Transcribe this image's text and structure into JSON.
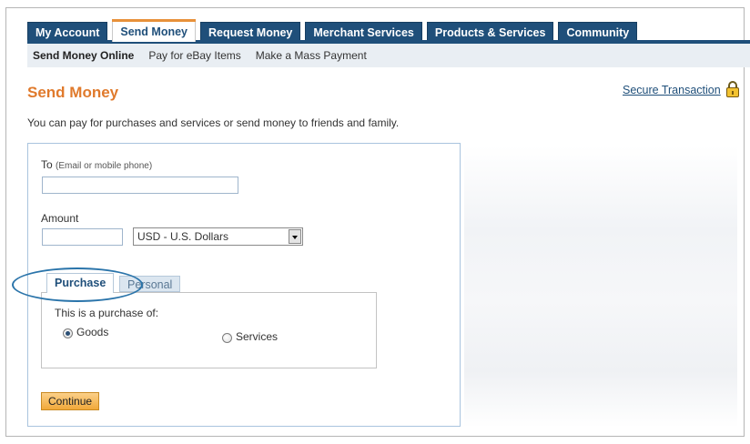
{
  "nav": {
    "tabs": [
      "My Account",
      "Send Money",
      "Request Money",
      "Merchant Services",
      "Products & Services",
      "Community"
    ],
    "active_tab": "Send Money",
    "subnav": [
      "Send Money Online",
      "Pay for eBay Items",
      "Make a Mass Payment"
    ]
  },
  "page": {
    "title": "Send Money",
    "secure_link": "Secure Transaction",
    "intro": "You can pay for purchases and services or send money to friends and family."
  },
  "form": {
    "to_label": "To",
    "to_hint": "(Email or mobile phone)",
    "to_value": "",
    "amount_label": "Amount",
    "amount_value": "",
    "currency_selected": "USD - U.S. Dollars",
    "payment_tabs": [
      "Purchase",
      "Personal"
    ],
    "purchase_prompt": "This is a purchase of:",
    "option_goods": "Goods",
    "option_services": "Services",
    "continue_label": "Continue"
  },
  "colors": {
    "nav_blue": "#1f4f7a",
    "title_orange": "#e07a2c",
    "highlight_circle": "#2a74aa"
  }
}
